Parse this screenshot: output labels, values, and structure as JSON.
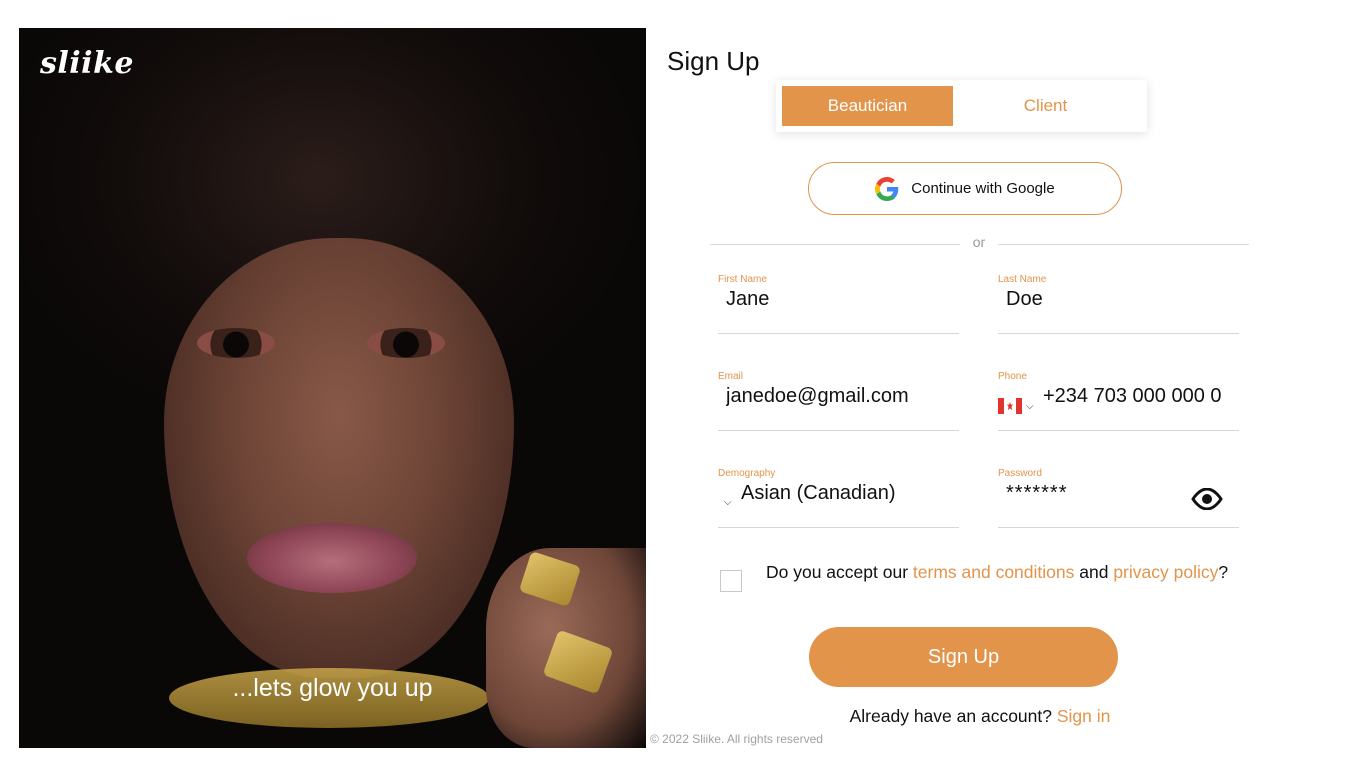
{
  "brand": {
    "logo_text": "sliike",
    "tagline": "...lets glow you up",
    "accent_color": "#e2944a"
  },
  "page": {
    "title": "Sign Up"
  },
  "role_toggle": {
    "options": [
      "Beautician",
      "Client"
    ],
    "selected": "Beautician"
  },
  "google": {
    "label": "Continue with Google",
    "icon": "google-icon"
  },
  "divider": {
    "text": "or"
  },
  "fields": {
    "first_name": {
      "label": "First Name",
      "value": "Jane"
    },
    "last_name": {
      "label": "Last Name",
      "value": "Doe"
    },
    "email": {
      "label": "Email",
      "value": "janedoe@gmail.com"
    },
    "phone": {
      "label": "Phone",
      "value": "+234 703 000 000 0",
      "country_flag": "canada-flag-icon"
    },
    "demography": {
      "label": "Demography",
      "value": "Asian (Canadian)"
    },
    "password": {
      "label": "Password",
      "value": "*******",
      "toggle_icon": "eye-icon"
    }
  },
  "terms": {
    "prefix": "Do you accept our ",
    "terms_link": "terms and conditions",
    "middle": " and ",
    "privacy_link": "privacy policy",
    "suffix": "?"
  },
  "submit": {
    "label": "Sign Up"
  },
  "signin": {
    "prompt": "Already have an account? ",
    "link": "Sign in"
  },
  "footer": {
    "copyright": "© 2022 Sliike. All rights reserved"
  }
}
